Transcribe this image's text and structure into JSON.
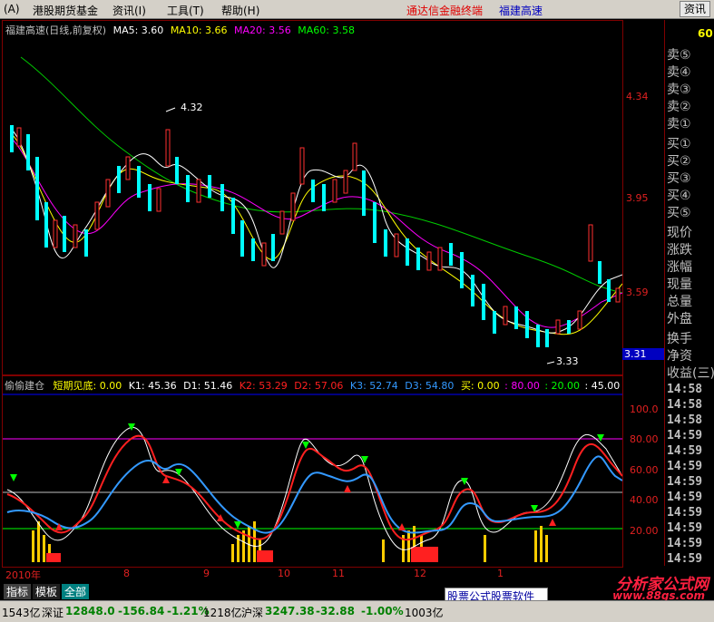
{
  "menubar": {
    "items": [
      "(A)",
      "港股期货基金",
      "资讯(I)",
      "工具(T)",
      "帮助(H)"
    ],
    "title": "通达信金融终端",
    "stock_name": "福建高速",
    "consult": "资讯"
  },
  "main_chart": {
    "header": "福建高速(日线,前复权)",
    "ma_labels": [
      {
        "label": "MA5: 3.60",
        "color": "#ffffff"
      },
      {
        "label": "MA10: 3.66",
        "color": "#ffff00"
      },
      {
        "label": "MA20: 3.56",
        "color": "#ff00ff"
      },
      {
        "label": "MA60: 3.58",
        "color": "#00ff00"
      }
    ],
    "annot_high": "4.32",
    "annot_low": "3.33",
    "price_ticks": [
      "4.34",
      "3.95",
      "3.59"
    ],
    "current_price": "3.31"
  },
  "sub_chart": {
    "indicator": "偷偷建仓",
    "legend": [
      {
        "label": "短期见底: 0.00",
        "color": "#ffff00"
      },
      {
        "label": "K1: 45.36",
        "color": "#ffffff"
      },
      {
        "label": "D1: 51.46",
        "color": "#ffffff"
      },
      {
        "label": "K2: 53.29",
        "color": "#ff2020"
      },
      {
        "label": "D2: 57.06",
        "color": "#ff2020"
      },
      {
        "label": "K3: 52.74",
        "color": "#3399ff"
      },
      {
        "label": "D3: 54.80",
        "color": "#3399ff"
      },
      {
        "label": "买: 0.00",
        "color": "#ffff00"
      },
      {
        "label": ": 80.00",
        "color": "#ff00ff"
      },
      {
        "label": ": 20.00",
        "color": "#00ff00"
      },
      {
        "label": ": 45.00",
        "color": "#ffffff"
      }
    ],
    "ticks": [
      "100.0",
      "80.00",
      "60.00",
      "40.00",
      "20.00"
    ]
  },
  "side_panel": {
    "top_value": "60",
    "rows": [
      "卖⑤",
      "卖④",
      "卖③",
      "卖②",
      "卖①",
      "买①",
      "买②",
      "买③",
      "买④",
      "买⑤",
      "现价",
      "涨跌",
      "涨幅",
      "现量",
      "总量",
      "外盘",
      "换手",
      "净资",
      "收益(三)"
    ],
    "times": [
      "14:58",
      "14:58",
      "14:58",
      "14:59",
      "14:59",
      "14:59",
      "14:59",
      "14:59",
      "14:59",
      "14:59",
      "14:59",
      "14:59"
    ]
  },
  "date_axis": [
    "2010年",
    "8",
    "9",
    "10",
    "11",
    "12",
    "1"
  ],
  "bottom_tabs": [
    "指标",
    "模板",
    "全部"
  ],
  "status": {
    "vol1": "1543亿",
    "sz_label": "深证",
    "sz_val": "12848.0",
    "sz_chg": "-156.84",
    "sz_pct": "-1.21%",
    "vol2": "1218亿",
    "hs_label": "沪深",
    "hs_val": "3247.38",
    "hs_chg": "-32.88",
    "hs_pct": "-1.00%",
    "vol3": "1003亿"
  },
  "ad": "股票公式股票软件",
  "watermark": {
    "name": "分析家公式网",
    "url": "www.88gs.com"
  }
}
